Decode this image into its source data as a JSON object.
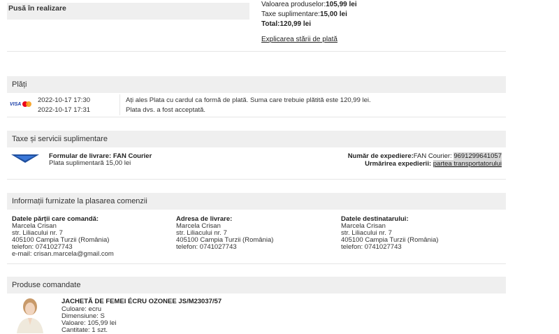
{
  "status": {
    "label": "Pusă în realizare"
  },
  "summary": {
    "products_label": "Valoarea produselor:",
    "products_value": "105,99 lei",
    "fees_label": "Taxe suplimentare:",
    "fees_value": "15,00 lei",
    "total_label": "Total:",
    "total_value": "120,99 lei",
    "explain_link": "Explicarea stării de plată"
  },
  "payments": {
    "title": "Plăți",
    "logo_text": "VISA",
    "rows": [
      {
        "datetime": "2022-10-17 17:30",
        "text": "Ați ales Plata cu cardul ca formă de plată. Suma care trebuie plătită este 120,99 lei."
      },
      {
        "datetime": "2022-10-17 17:31",
        "text": "Plata dvs. a fost acceptată."
      }
    ]
  },
  "fees": {
    "title": "Taxe și servicii suplimentare",
    "delivery_label": "Formular de livrare: FAN Courier",
    "delivery_fee": "Plata suplimentară 15,00 lei",
    "shipment_label": "Număr de expediere:",
    "shipment_carrier": "FAN Courier:",
    "shipment_number": "9691299641057",
    "tracking_label": "Urmărirea expedierii:",
    "tracking_link": "partea transportatorului"
  },
  "order_info": {
    "title": "Informații furnizate la plasarea comenzii",
    "columns": [
      {
        "heading": "Datele părții care comandă:",
        "lines": [
          "Marcela Crisan",
          "str. Liliacului nr. 7",
          "405100 Campia Turzii (România)",
          "telefon: 0741027743",
          "e-mail: crisan.marcela@gmail.com"
        ]
      },
      {
        "heading": "Adresa de livrare:",
        "lines": [
          "Marcela Crisan",
          "str. Liliacului nr. 7",
          "405100 Campia Turzii (România)",
          "telefon: 0741027743"
        ]
      },
      {
        "heading": "Datele destinatarului:",
        "lines": [
          "Marcela Crisan",
          "str. Liliacului nr. 7",
          "405100 Campia Turzii (România)",
          "telefon: 0741027743"
        ]
      }
    ]
  },
  "products": {
    "title": "Produse comandate",
    "items": [
      {
        "name": "JACHETĂ DE FEMEI ÉCRU OZONEE JS/M23037/57",
        "color": "Culoare: ecru",
        "size": "Dimensiune: S",
        "value": "Valoare: 105,99 lei",
        "quantity": "Cantitate: 1 szt."
      }
    ]
  },
  "colors": {
    "header_bg": "#efefef",
    "visa_blue": "#1a3ea8",
    "mc_red": "#eb001b",
    "mc_orange": "#f79e1b",
    "fan_blue": "#1f4f9e"
  }
}
